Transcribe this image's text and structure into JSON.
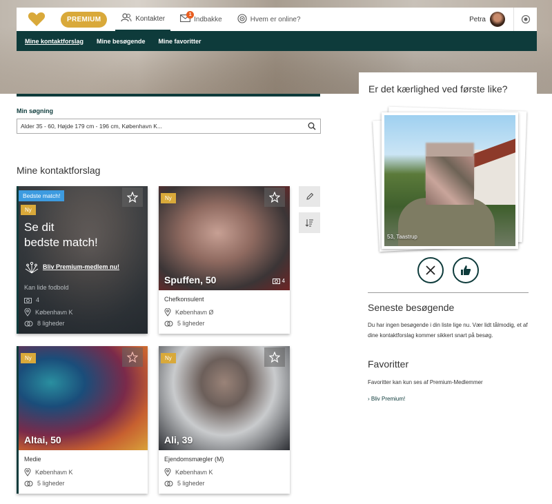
{
  "header": {
    "premium_label": "PREMIUM",
    "tabs": [
      {
        "label": "Kontakter",
        "icon": "contacts-icon"
      },
      {
        "label": "Indbakke",
        "icon": "mail-icon",
        "badge": "1"
      },
      {
        "label": "Hvem er online?",
        "icon": "online-icon"
      }
    ],
    "user_name": "Petra"
  },
  "subnav": [
    "Mine kontaktforslag",
    "Mine besøgende",
    "Mine favoritter"
  ],
  "search": {
    "label": "Min søgning",
    "value": "Alder 35 - 60, Højde 179 cm - 196 cm, København K..."
  },
  "section_title": "Mine kontaktforslag",
  "cards": [
    {
      "badge": "Bedste match!",
      "ny": "Ny",
      "headline_1": "Se dit",
      "headline_2": "bedste match!",
      "premium_link": "Bliv Premium-medlem nu!",
      "occupation": "Kan lide fodbold",
      "photos": "4",
      "location": "København K",
      "likes": "8 ligheder"
    },
    {
      "ny": "Ny",
      "name": "Spuffen, 50",
      "photos": "4",
      "occupation": "Chefkonsulent",
      "location": "København Ø",
      "likes": "5 ligheder"
    },
    {
      "ny": "Ny",
      "name": "Altai, 50",
      "occupation": "Medie",
      "location": "København K",
      "likes": "5 ligheder"
    },
    {
      "ny": "Ny",
      "name": "Ali, 39",
      "occupation": "Ejendomsmægler (M)",
      "location": "København K",
      "likes": "5 ligheder"
    }
  ],
  "like_panel": {
    "title": "Er det kærlighed ved første like?",
    "caption": "53, Taastrup"
  },
  "visitors": {
    "title": "Seneste besøgende",
    "text": "Du har ingen besøgende i din liste lige nu. Vær lidt tålmodig, et af dine kontaktforslag kommer sikkert snart på besøg."
  },
  "favorites": {
    "title": "Favoritter",
    "text": "Favoritter kan kun ses af Premium-Medlemmer",
    "link": "Bliv Premium!"
  },
  "colors": {
    "brand": "#0e3b3b",
    "gold": "#d9a93a",
    "blue_badge": "#3d9be0",
    "notify": "#e85d20"
  }
}
